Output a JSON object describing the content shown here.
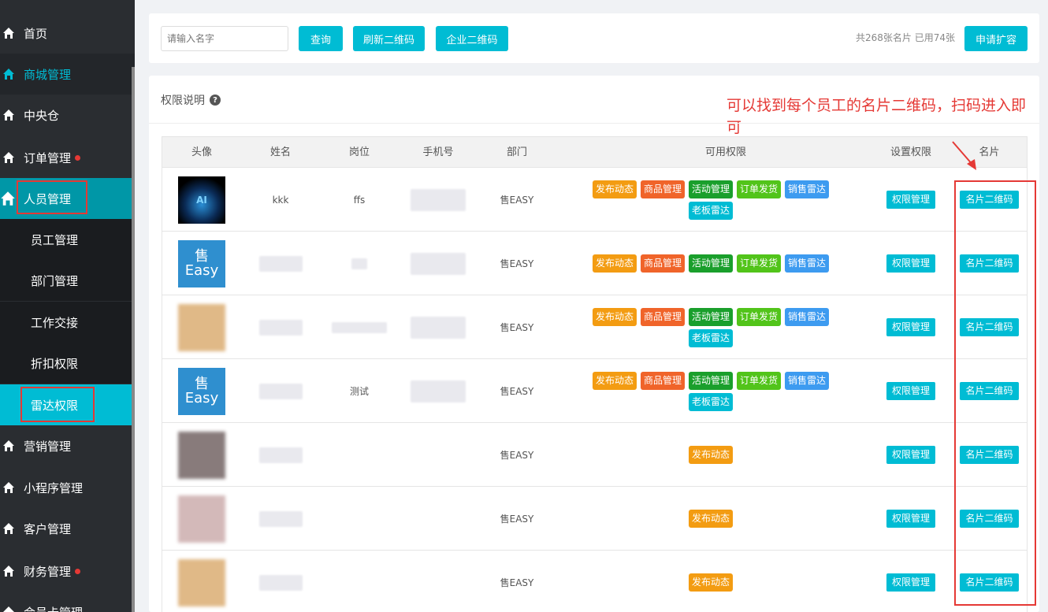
{
  "sidebar": {
    "items": [
      {
        "label": "首页"
      },
      {
        "label": "商城管理"
      },
      {
        "label": "中央仓"
      },
      {
        "label": "订单管理"
      },
      {
        "label": "人员管理"
      },
      {
        "label": "员工管理"
      },
      {
        "label": "部门管理"
      },
      {
        "label": "工作交接"
      },
      {
        "label": "折扣权限"
      },
      {
        "label": "雷达权限"
      },
      {
        "label": "营销管理"
      },
      {
        "label": "小程序管理"
      },
      {
        "label": "客户管理"
      },
      {
        "label": "财务管理"
      },
      {
        "label": "会员卡管理"
      }
    ]
  },
  "toolbar": {
    "search_placeholder": "请输入名字",
    "query": "查询",
    "refresh_qr": "刷新二维码",
    "enterprise_qr": "企业二维码",
    "quota_text": "共268张名片 已用74张",
    "expand": "申请扩容"
  },
  "section": {
    "title": "权限说明",
    "help": "?"
  },
  "annotation": "可以找到每个员工的名片二维码，扫码进入即可",
  "table": {
    "headers": [
      "头像",
      "姓名",
      "岗位",
      "手机号",
      "部门",
      "可用权限",
      "设置权限",
      "名片"
    ],
    "perm_button": "权限管理",
    "card_button": "名片二维码",
    "tags": {
      "publish": "发布动态",
      "goods": "商品管理",
      "activity": "活动管理",
      "order": "订单发货",
      "radar": "销售雷达",
      "boss": "老板雷达"
    },
    "rows": [
      {
        "name": "kkk",
        "post": "ffs",
        "dept": "售EASY",
        "avatar": "AI"
      },
      {
        "name": "",
        "post": "",
        "dept": "售EASY",
        "avatar": "Easy"
      },
      {
        "name": "",
        "post": "",
        "dept": "售EASY",
        "avatar": ""
      },
      {
        "name": "",
        "post": "测试",
        "dept": "售EASY",
        "avatar": "Easy"
      },
      {
        "name": "",
        "post": "",
        "dept": "售EASY",
        "avatar": ""
      },
      {
        "name": "",
        "post": "",
        "dept": "售EASY",
        "avatar": ""
      },
      {
        "name": "",
        "post": "",
        "dept": "售EASY",
        "avatar": ""
      }
    ],
    "avatar_glyph": "售"
  },
  "colors": {
    "accent": "#00bcd4",
    "orange": "#f39c12",
    "red_orange": "#f0642a",
    "green": "#1a9f2c",
    "lime": "#52c41a",
    "blue": "#3d9bf0",
    "annotation_red": "#e53935"
  }
}
